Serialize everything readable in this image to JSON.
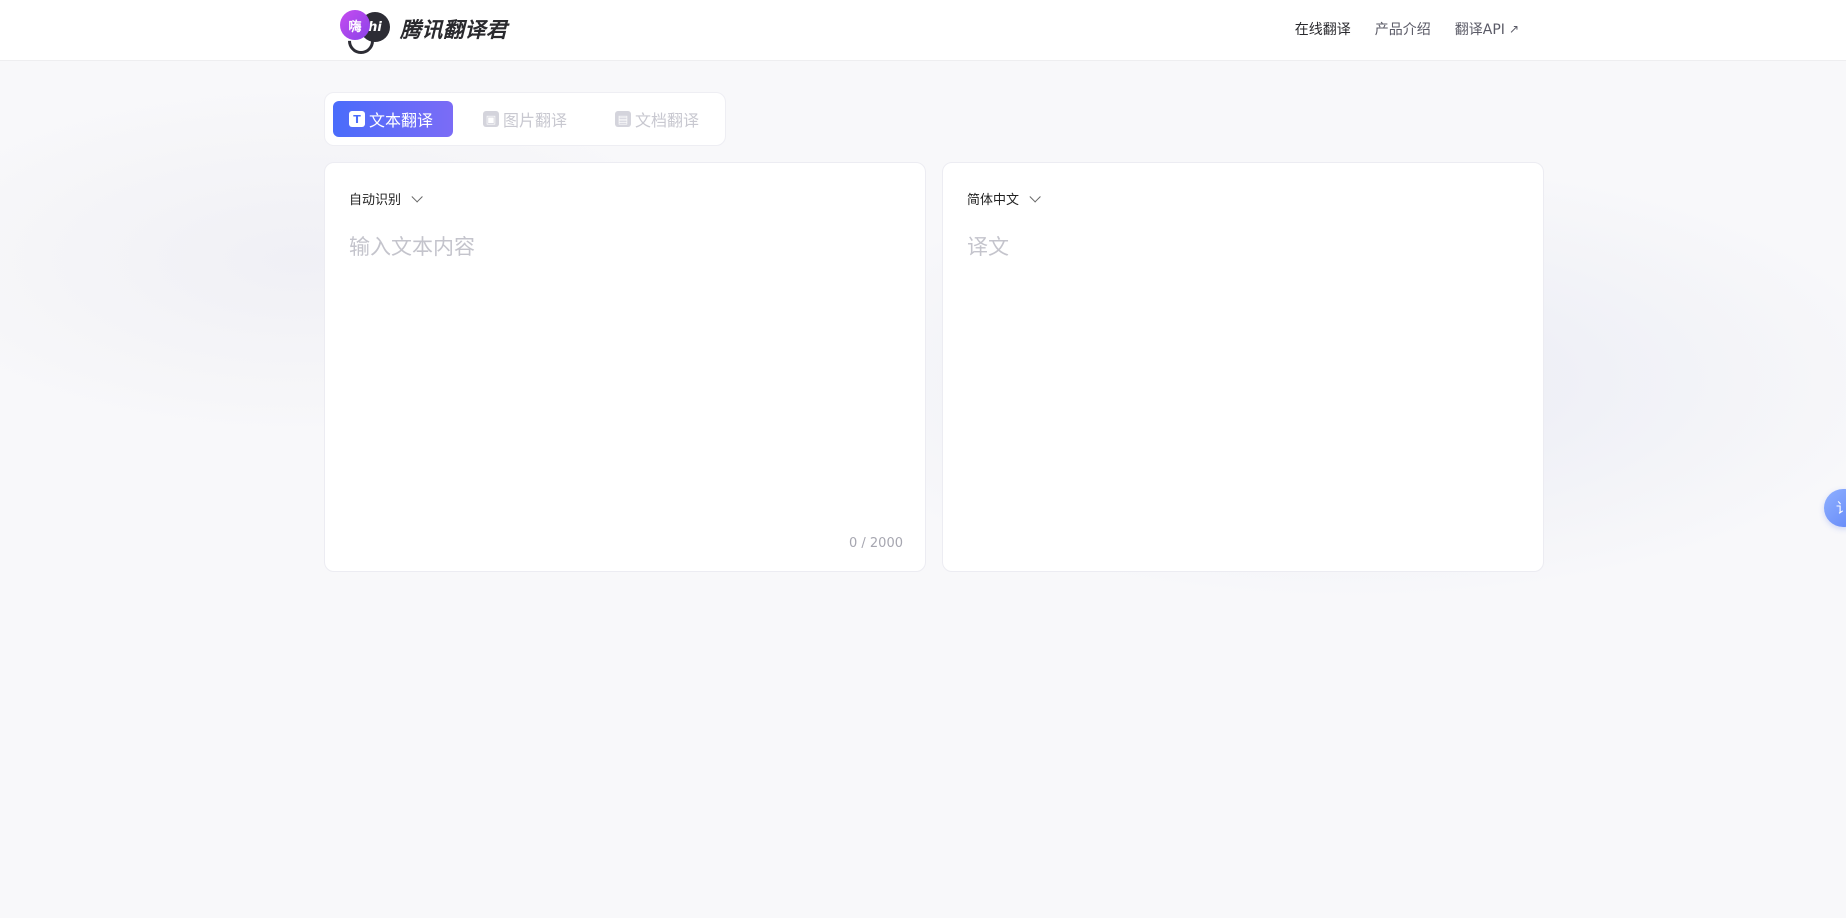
{
  "header": {
    "logo_badge_a": "嗨",
    "logo_badge_b": "hi",
    "logo_text": "腾讯翻译君",
    "nav": [
      {
        "label": "在线翻译"
      },
      {
        "label": "产品介绍"
      },
      {
        "label": "翻译API",
        "icon": "external-arrow-icon",
        "icon_glyph": "↗"
      }
    ]
  },
  "mode_tabs": [
    {
      "label": "文本翻译",
      "icon": "text-icon",
      "icon_glyph": "T",
      "active": true
    },
    {
      "label": "图片翻译",
      "icon": "image-icon",
      "icon_glyph": "▣",
      "active": false
    },
    {
      "label": "文档翻译",
      "icon": "document-icon",
      "icon_glyph": "▤",
      "active": false
    }
  ],
  "source": {
    "language": "自动识别",
    "value": "",
    "placeholder": "输入文本内容",
    "char_count": "0 / 2000"
  },
  "target": {
    "language": "简体中文",
    "placeholder": "译文"
  },
  "float_button": {
    "glyph": "讠"
  },
  "colors": {
    "accent_start": "#4a6cfb",
    "accent_end": "#7b6cf6",
    "page_bg": "#f8f8fa"
  }
}
